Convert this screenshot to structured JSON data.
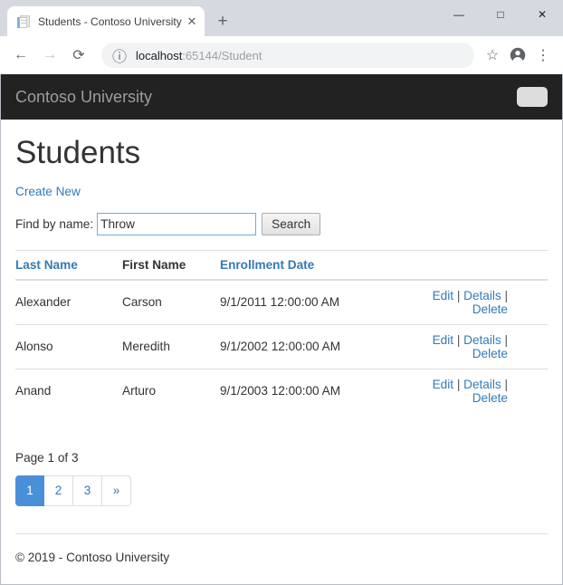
{
  "browser": {
    "tab": {
      "title": "Students - Contoso University",
      "favicon_name": "document-favicon",
      "close_glyph": "✕"
    },
    "new_tab_glyph": "+",
    "window_controls": {
      "minimize": "—",
      "maximize": "□",
      "close": "✕"
    },
    "toolbar": {
      "back_glyph": "←",
      "forward_glyph": "→",
      "reload_glyph": "⟳",
      "site_info_glyph": "ⓘ",
      "url_host": "localhost",
      "url_path": ":65144/Student",
      "bookmark_glyph": "☆",
      "menu_glyph": "⋮"
    }
  },
  "site": {
    "brand": "Contoso University",
    "toggler_name": "navbar-toggler"
  },
  "page": {
    "title": "Students",
    "create_new_label": "Create New"
  },
  "search": {
    "label": "Find by name:",
    "value": "Throw",
    "placeholder": "",
    "button_label": "Search"
  },
  "table": {
    "columns": [
      {
        "label": "Last Name",
        "sortable": true
      },
      {
        "label": "First Name",
        "sortable": false
      },
      {
        "label": "Enrollment Date",
        "sortable": true
      }
    ],
    "rows": [
      {
        "last_name": "Alexander",
        "first_name": "Carson",
        "enrollment_date": "9/1/2011 12:00:00 AM",
        "actions": {
          "edit": "Edit",
          "details": "Details",
          "delete": "Delete"
        }
      },
      {
        "last_name": "Alonso",
        "first_name": "Meredith",
        "enrollment_date": "9/1/2002 12:00:00 AM",
        "actions": {
          "edit": "Edit",
          "details": "Details",
          "delete": "Delete"
        }
      },
      {
        "last_name": "Anand",
        "first_name": "Arturo",
        "enrollment_date": "9/1/2003 12:00:00 AM",
        "actions": {
          "edit": "Edit",
          "details": "Details",
          "delete": "Delete"
        }
      }
    ],
    "action_separator": "|"
  },
  "pager": {
    "indicator": "Page 1 of 3",
    "current_page": 1,
    "total_pages": 3,
    "items": [
      {
        "label": "1",
        "active": true
      },
      {
        "label": "2",
        "active": false
      },
      {
        "label": "3",
        "active": false
      },
      {
        "label": "»",
        "active": false
      }
    ]
  },
  "footer": {
    "text": "© 2019 - Contoso University"
  },
  "colors": {
    "navbar_bg": "#222222",
    "brand_text": "#9d9d9d",
    "link_blue": "#337ab7",
    "pager_active_bg": "#4a90d9",
    "input_focus_border": "#66afe9"
  }
}
